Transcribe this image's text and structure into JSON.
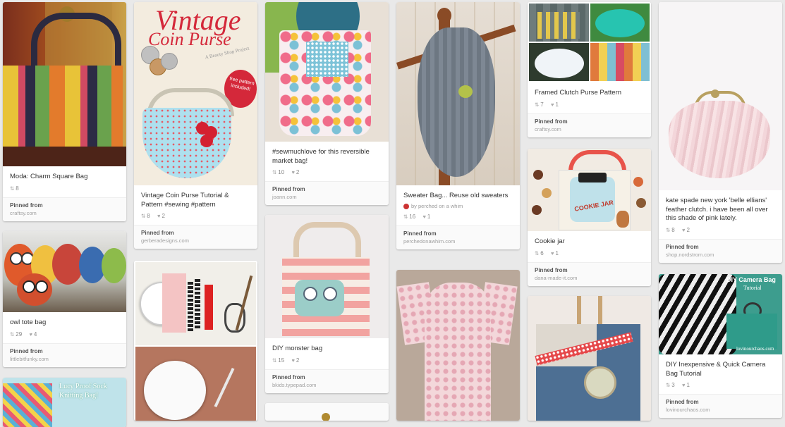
{
  "pins": {
    "charm": {
      "description": "Moda: Charm Square Bag",
      "repins": "8",
      "pinned_from": "Pinned from",
      "domain": "craftsy.com"
    },
    "coin": {
      "overlay_title": "Vintage",
      "overlay_subtitle": "Coin Purse",
      "overlay_tag": "A Beauty Shop Project",
      "overlay_badge": "free pattern included!",
      "description": "Vintage Coin Purse Tutorial & Pattern #sewing #pattern",
      "repins": "8",
      "likes": "2",
      "pinned_from": "Pinned from",
      "domain": "gerberadesigns.com"
    },
    "market": {
      "description": "#sewmuchlove for this reversible market bag!",
      "repins": "10",
      "likes": "2",
      "pinned_from": "Pinned from",
      "domain": "joann.com"
    },
    "sweater": {
      "description": "Sweater Bag... Reuse old sweaters",
      "pinner": "by perched on a whim",
      "repins": "16",
      "likes": "1",
      "pinned_from": "Pinned from",
      "domain": "perchedonawhim.com"
    },
    "clutch": {
      "description": "Framed Clutch Purse Pattern",
      "repins": "7",
      "likes": "1",
      "pinned_from": "Pinned from",
      "domain": "craftsy.com"
    },
    "kate": {
      "description": "kate spade new york 'belle ellians' feather clutch. i have been all over this shade of pink lately.",
      "repins": "8",
      "likes": "2",
      "pinned_from": "Pinned from",
      "domain": "shop.nordstrom.com"
    },
    "owl": {
      "description": "owl tote bag",
      "repins": "29",
      "likes": "4",
      "pinned_from": "Pinned from",
      "domain": "littlebitfunky.com"
    },
    "monster": {
      "description": "DIY monster bag",
      "repins": "15",
      "likes": "2",
      "pinned_from": "Pinned from",
      "domain": "bkids.typepad.com"
    },
    "cookie": {
      "overlay_label": "COOKIE JAR",
      "description": "Cookie jar",
      "repins": "6",
      "likes": "1",
      "pinned_from": "Pinned from",
      "domain": "dana-made-it.com"
    },
    "camera": {
      "overlay_title": "DIY Camera Bag",
      "overlay_sub": "Tutorial",
      "overlay_credit": "lovinourchaos.com",
      "description": "DIY Inexpensive & Quick Camera Bag Tutorial",
      "repins": "3",
      "likes": "1",
      "pinned_from": "Pinned from",
      "domain": "lovinourchaos.com"
    },
    "sock": {
      "overlay_text": "Lucy Proof Sock Knitting Bag!"
    }
  },
  "icons": {
    "repin": "repin-icon",
    "like": "heart-icon"
  },
  "colors": {
    "background": "#e9e9e9",
    "card": "#ffffff",
    "source_bg": "#fafafa"
  }
}
